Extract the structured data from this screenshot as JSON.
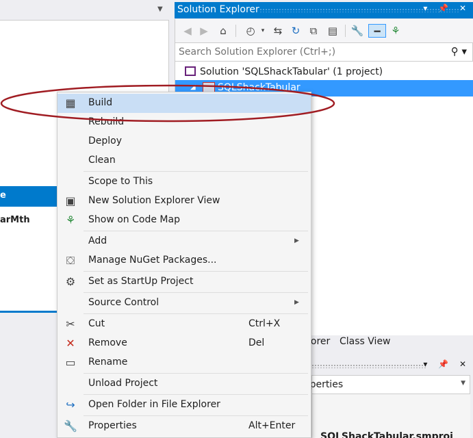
{
  "left_panel": {
    "header_fragment": "e",
    "item_fragment": "arMth"
  },
  "solution_explorer": {
    "title": "Solution Explorer",
    "title_buttons": "▾ 📌 ✕",
    "search_placeholder": "Search Solution Explorer (Ctrl+;)",
    "solution_label": "Solution 'SQLShackTabular' (1 project)",
    "project_label": "SQLShackTabular",
    "bottom_tabs": [
      "lorer",
      "Class View"
    ]
  },
  "properties": {
    "title_buttons": "▾ 📌 ✕",
    "combo_text": "operties",
    "bottom_text": "SQLShackTabular.smproj"
  },
  "context_menu": {
    "build": "Build",
    "rebuild": "Rebuild",
    "deploy": "Deploy",
    "clean": "Clean",
    "scope_to_this": "Scope to This",
    "new_se_view": "New Solution Explorer View",
    "show_on_code_map": "Show on Code Map",
    "add": "Add",
    "manage_nuget": "Manage NuGet Packages...",
    "set_startup": "Set as StartUp Project",
    "source_control": "Source Control",
    "cut": "Cut",
    "cut_shortcut": "Ctrl+X",
    "remove": "Remove",
    "remove_shortcut": "Del",
    "rename": "Rename",
    "unload": "Unload Project",
    "open_folder": "Open Folder in File Explorer",
    "properties": "Properties",
    "properties_shortcut": "Alt+Enter"
  },
  "colors": {
    "accent": "#007acc",
    "selection": "#3399ff",
    "menu_highlight": "#c9def5",
    "annotation": "#a01c22"
  }
}
